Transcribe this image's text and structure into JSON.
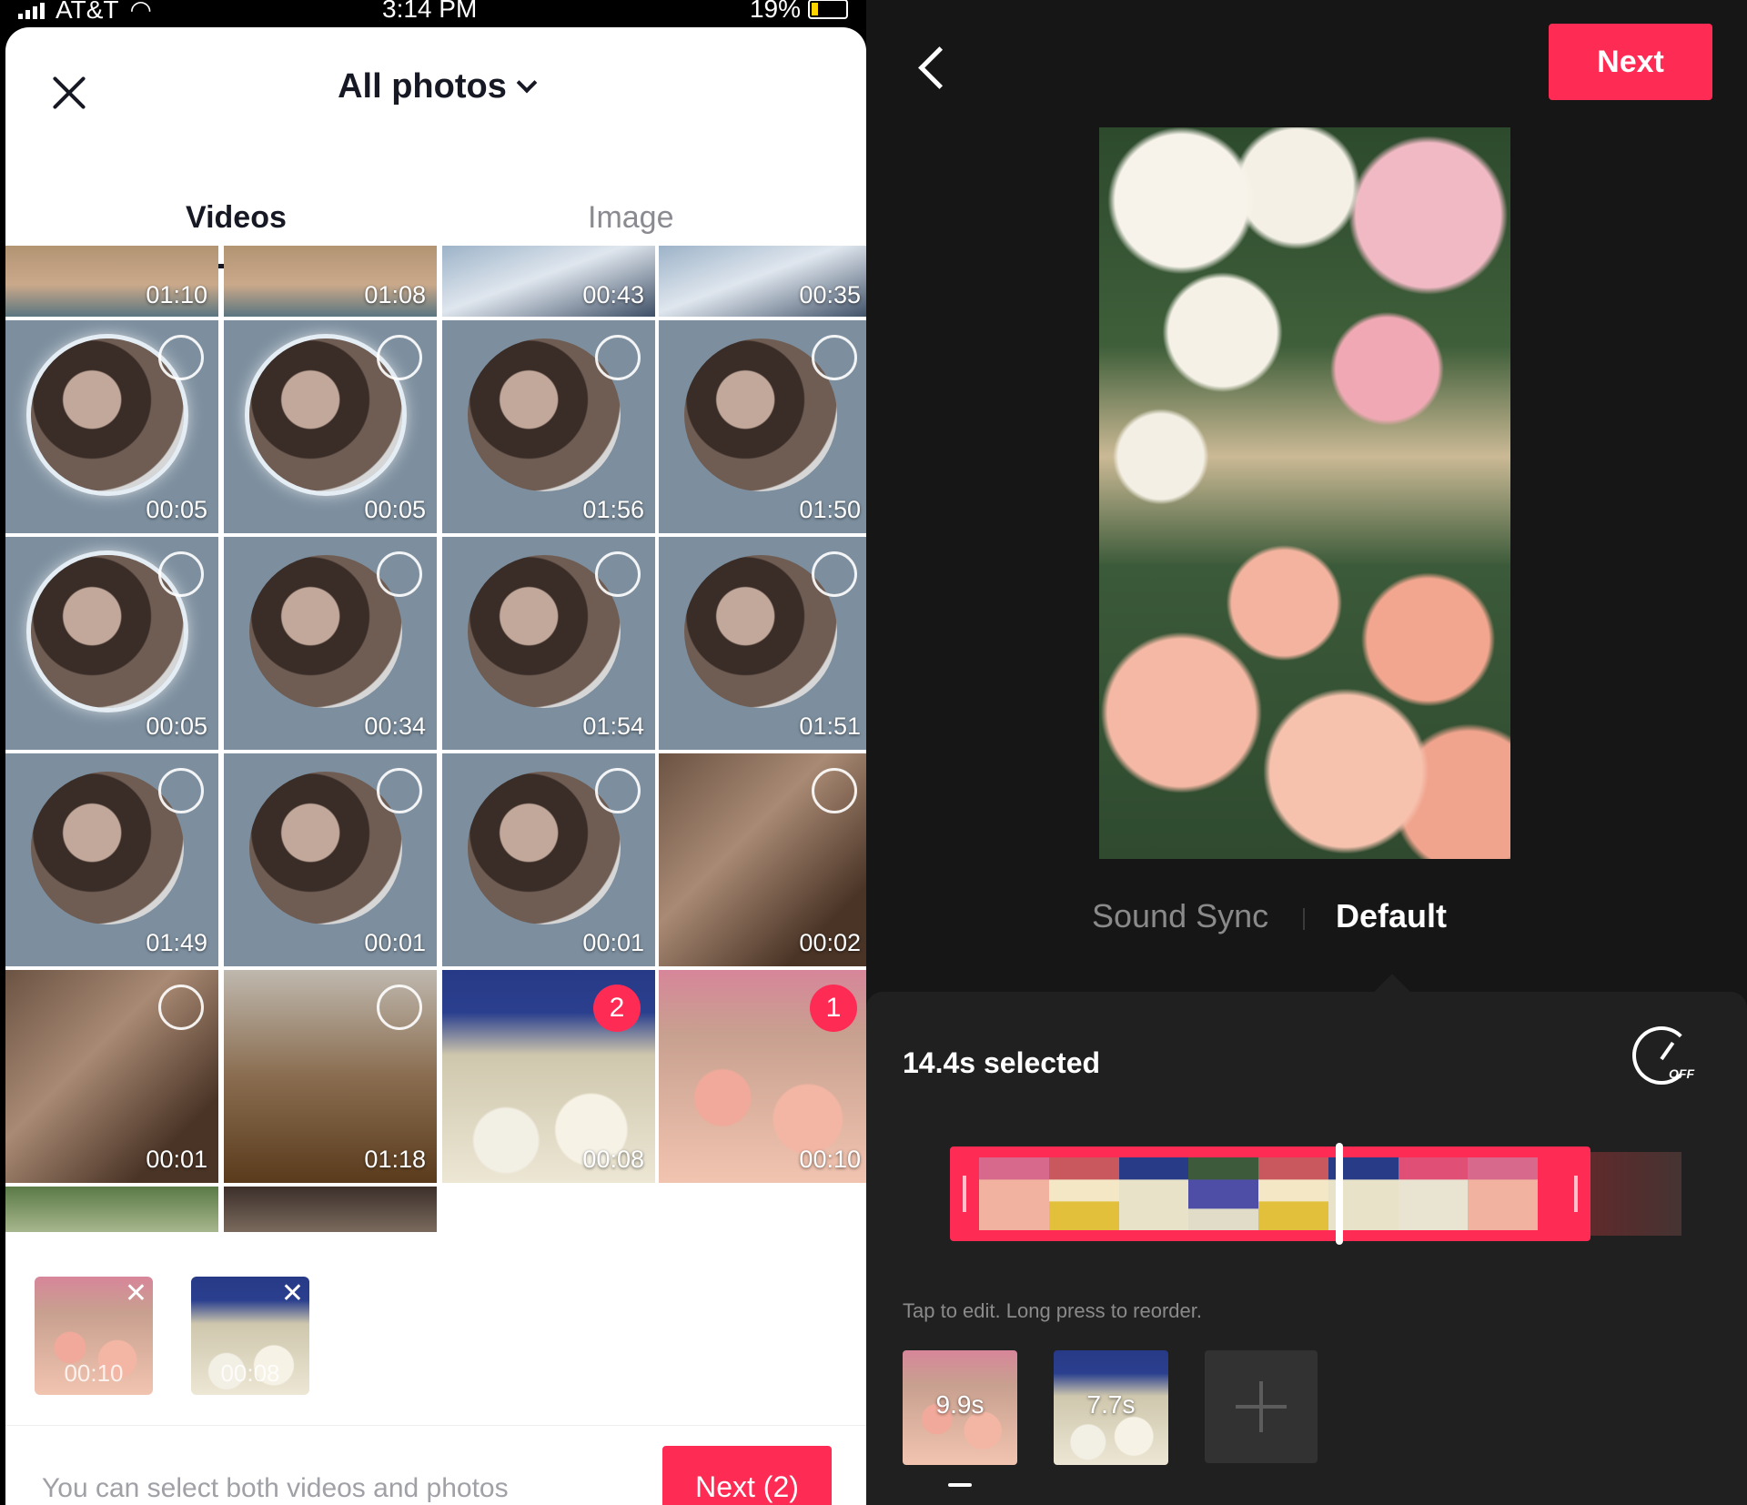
{
  "status_bar": {
    "carrier": "AT&T",
    "time": "3:14 PM",
    "battery": "19%",
    "battery_fraction": 0.19
  },
  "picker": {
    "album_title": "All photos",
    "tabs": [
      {
        "label": "Videos",
        "active": true
      },
      {
        "label": "Image",
        "active": false
      }
    ],
    "grid": [
      {
        "duration": "01:10"
      },
      {
        "duration": "01:08"
      },
      {
        "duration": "00:43"
      },
      {
        "duration": "00:35"
      },
      {
        "duration": "00:05"
      },
      {
        "duration": "00:05"
      },
      {
        "duration": "01:56"
      },
      {
        "duration": "01:50"
      },
      {
        "duration": "00:05"
      },
      {
        "duration": "00:34"
      },
      {
        "duration": "01:54"
      },
      {
        "duration": "01:51"
      },
      {
        "duration": "01:49"
      },
      {
        "duration": "00:01"
      },
      {
        "duration": "00:01"
      },
      {
        "duration": "00:02"
      },
      {
        "duration": "00:01"
      },
      {
        "duration": "01:18"
      },
      {
        "duration": "00:08",
        "selection_number": "2"
      },
      {
        "duration": "00:10",
        "selection_number": "1"
      }
    ],
    "selected": [
      {
        "duration": "00:10"
      },
      {
        "duration": "00:08"
      }
    ],
    "hint": "You can select both videos and photos",
    "next_label": "Next (2)"
  },
  "editor": {
    "next_label": "Next",
    "modes": [
      {
        "label": "Sound Sync",
        "active": false
      },
      {
        "label": "Default",
        "active": true
      }
    ],
    "selected_text": "14.4s selected",
    "speed_icon_label": "OFF",
    "tap_hint": "Tap to edit. Long press to reorder.",
    "clips": [
      {
        "duration": "9.9s"
      },
      {
        "duration": "7.7s"
      }
    ]
  },
  "colors": {
    "accent": "#fe2c55",
    "editor_bg": "#161616",
    "panel_bg": "#202020"
  }
}
